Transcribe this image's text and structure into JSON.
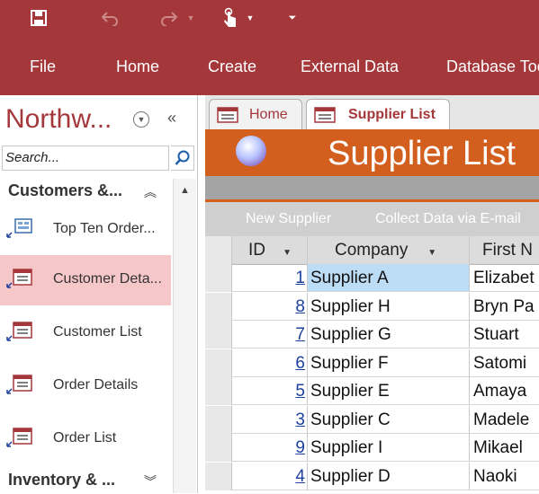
{
  "ribbon": {
    "menu": [
      "File",
      "Home",
      "Create",
      "External Data",
      "Database Tools"
    ]
  },
  "nav": {
    "title": "Northw...",
    "search_placeholder": "Search...",
    "groups": [
      {
        "label": "Customers &...",
        "chevron": "⌃"
      },
      {
        "label": "Inventory & ...",
        "chevron": "⌄"
      }
    ],
    "items": [
      {
        "label": "Top Ten Order...",
        "selected": false
      },
      {
        "label": "Customer Deta...",
        "selected": true
      },
      {
        "label": "Customer List",
        "selected": false
      },
      {
        "label": "Order Details",
        "selected": false
      },
      {
        "label": "Order List",
        "selected": false
      }
    ]
  },
  "tabs": [
    {
      "label": "Home",
      "active": false
    },
    {
      "label": "Supplier List",
      "active": true
    }
  ],
  "form": {
    "title": "Supplier List",
    "links": [
      "New Supplier",
      "Collect Data via E-mail"
    ]
  },
  "table": {
    "columns": [
      "ID",
      "Company",
      "First N"
    ],
    "rows": [
      {
        "id": "1",
        "company": "Supplier A",
        "first": "Elizabet",
        "selected": true
      },
      {
        "id": "8",
        "company": "Supplier H",
        "first": "Bryn Pa"
      },
      {
        "id": "7",
        "company": "Supplier G",
        "first": "Stuart"
      },
      {
        "id": "6",
        "company": "Supplier F",
        "first": "Satomi"
      },
      {
        "id": "5",
        "company": "Supplier E",
        "first": "Amaya"
      },
      {
        "id": "3",
        "company": "Supplier C",
        "first": "Madele"
      },
      {
        "id": "9",
        "company": "Supplier I",
        "first": "Mikael"
      },
      {
        "id": "4",
        "company": "Supplier D",
        "first": "Naoki"
      }
    ]
  },
  "colors": {
    "accent": "#a4373a",
    "header_orange": "#d35f1f",
    "selection": "#f6c7c8"
  }
}
